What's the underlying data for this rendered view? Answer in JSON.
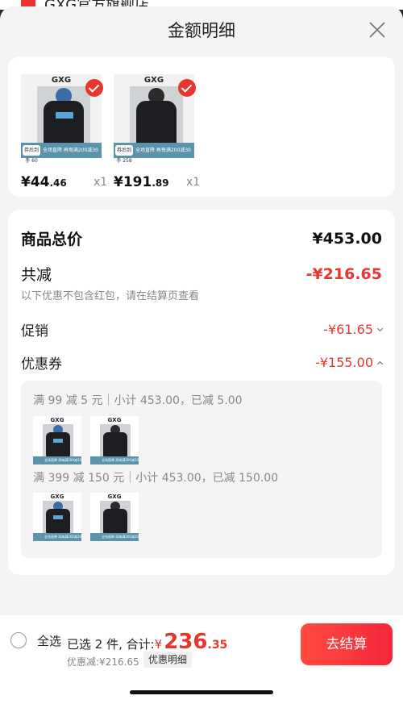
{
  "background_header": {
    "text": "GXG官方旗舰店"
  },
  "sheet": {
    "title": "金额明细",
    "close_icon": "close-icon"
  },
  "products": [
    {
      "brand": "GXG",
      "band_tag": "券后到手\n60",
      "band_text": "全场直降 再每满200减30",
      "price_int": "¥44",
      "price_dec": ".46",
      "qty": "x1",
      "selected": true
    },
    {
      "brand": "GXG",
      "band_tag": "券后到手\n258",
      "band_text": "全场直降 再每满200减30",
      "price_int": "¥191",
      "price_dec": ".89",
      "qty": "x1",
      "selected": true
    }
  ],
  "summary": {
    "total_label": "商品总价",
    "total_value": "¥453.00",
    "reduce_label": "共减",
    "reduce_value": "-¥216.65",
    "note": "以下优惠不包含红包，请在结算页查看",
    "promo_label": "促销",
    "promo_value": "-¥61.65",
    "coupon_label": "优惠券",
    "coupon_value": "-¥155.00"
  },
  "coupons": [
    {
      "text": "满 99 减 5 元｜小计 453.00，已减 5.00"
    },
    {
      "text": "满 399 减 150 元｜小计 453.00，已减 150.00"
    }
  ],
  "mini_brand": "GXG",
  "mini_band_text": "全场直降 再每满200减30",
  "footer": {
    "select_all": "全选",
    "selected_text": "已选 2 件, 合计:",
    "currency": "¥",
    "total_int": "236",
    "total_dec": ".35",
    "discount_text": "优惠减:¥216.65",
    "detail_button": "优惠明细",
    "checkout_button": "去结算"
  },
  "colors": {
    "accent": "#e8362f",
    "band": "#5b93ad",
    "sheet_bg": "#f4f4f6"
  }
}
